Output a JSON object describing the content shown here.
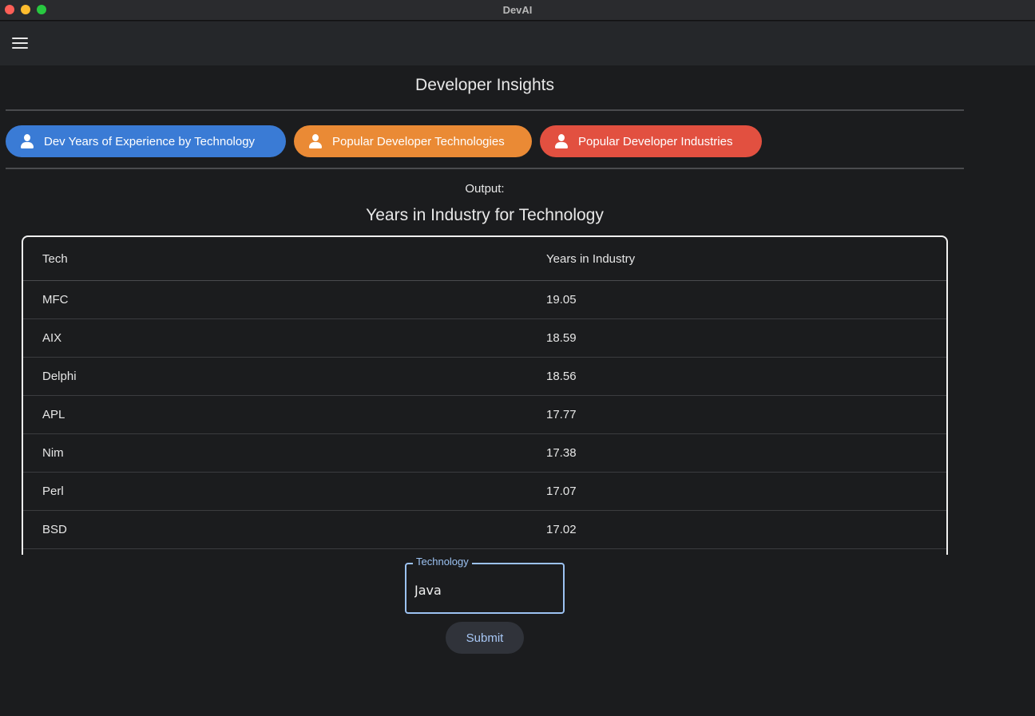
{
  "window": {
    "title": "DevAI"
  },
  "appbar": {
    "menu_icon": "hamburger-menu-icon"
  },
  "page": {
    "title": "Developer Insights"
  },
  "tabs": [
    {
      "label": "Dev Years of Experience by Technology",
      "icon": "person-icon",
      "color": "#3a7bd5"
    },
    {
      "label": "Popular Developer Technologies",
      "icon": "person-icon",
      "color": "#ea8a35"
    },
    {
      "label": "Popular Developer Industries",
      "icon": "person-icon",
      "color": "#e25040"
    }
  ],
  "output": {
    "label": "Output:",
    "table_title": "Years in Industry for Technology",
    "columns": [
      "Tech",
      "Years in Industry"
    ],
    "rows": [
      {
        "tech": "MFC",
        "years": "19.05"
      },
      {
        "tech": "AIX",
        "years": "18.59"
      },
      {
        "tech": "Delphi",
        "years": "18.56"
      },
      {
        "tech": "APL",
        "years": "17.77"
      },
      {
        "tech": "Nim",
        "years": "17.38"
      },
      {
        "tech": "Perl",
        "years": "17.07"
      },
      {
        "tech": "BSD",
        "years": "17.02"
      }
    ]
  },
  "form": {
    "field_label": "Technology",
    "field_value": "Java",
    "submit_label": "Submit"
  }
}
